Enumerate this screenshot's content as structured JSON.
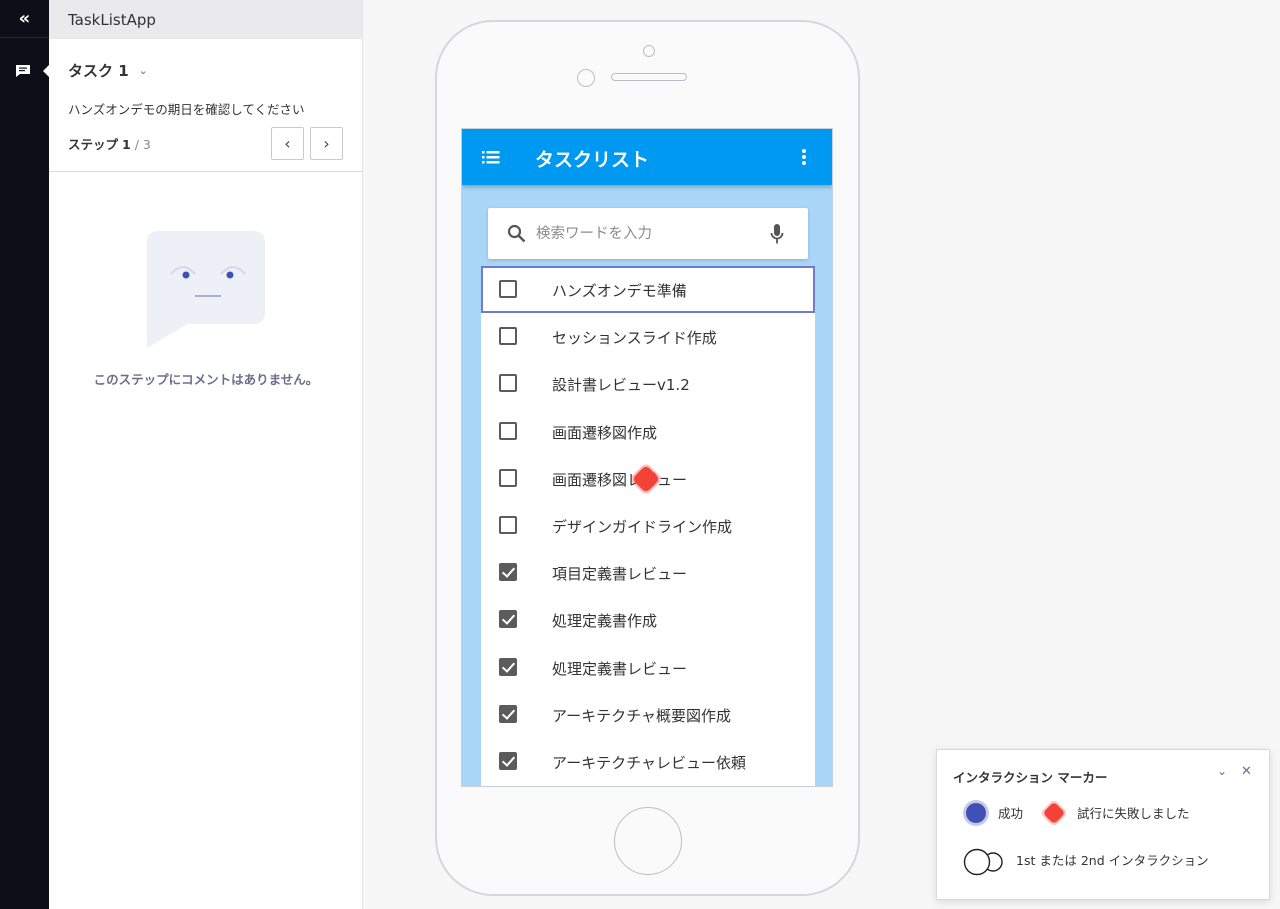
{
  "rail": {
    "collapse_glyph": "«",
    "comment_icon": "comment-icon"
  },
  "panel": {
    "app_name": "TaskListApp",
    "task_title": "タスク 1",
    "task_chevron": "⌄",
    "task_description": "ハンズオンデモの期日を確認してください",
    "step_label": "ステップ",
    "step_current": "1",
    "step_total": "/ 3",
    "prev_glyph": "‹",
    "next_glyph": "›",
    "empty_message": "このステップにコメントはありません。"
  },
  "app": {
    "title": "タスクリスト",
    "search_placeholder": "検索ワードを入力",
    "accent_color": "#0099f2",
    "tasks": [
      {
        "label": "ハンズオンデモ準備",
        "checked": false,
        "selected": true
      },
      {
        "label": "セッションスライド作成",
        "checked": false
      },
      {
        "label": "設計書レビューv1.2",
        "checked": false
      },
      {
        "label": "画面遷移図作成",
        "checked": false
      },
      {
        "label": "画面遷移図レビュー",
        "checked": false
      },
      {
        "label": "デザインガイドライン作成",
        "checked": false
      },
      {
        "label": "項目定義書レビュー",
        "checked": true
      },
      {
        "label": "処理定義書作成",
        "checked": true
      },
      {
        "label": "処理定義書レビュー",
        "checked": true
      },
      {
        "label": "アーキテクチャ概要図作成",
        "checked": true
      },
      {
        "label": "アーキテクチャレビュー依頼",
        "checked": true
      }
    ]
  },
  "legend": {
    "title": "インタラクション マーカー",
    "success_label": "成功",
    "failure_label": "試行に失敗しました",
    "sequence_label": "1st または 2nd インタラクション",
    "success_color": "#3f51b5",
    "failure_color": "#f44336",
    "chevron": "⌄",
    "close": "✕"
  }
}
